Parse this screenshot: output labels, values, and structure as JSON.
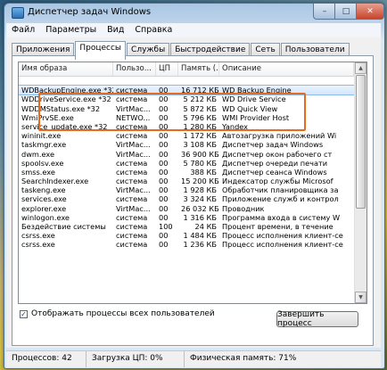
{
  "window": {
    "title": "Диспетчер задач Windows",
    "minimize": "–",
    "maximize": "□",
    "close": "✕"
  },
  "menu": [
    "Файл",
    "Параметры",
    "Вид",
    "Справка"
  ],
  "tabs": [
    "Приложения",
    "Процессы",
    "Службы",
    "Быстродействие",
    "Сеть",
    "Пользователи"
  ],
  "active_tab": "Процессы",
  "columns": [
    "Имя образа",
    "Пользо...",
    "ЦП",
    "Память (...",
    "Описание"
  ],
  "rows": [
    [
      "",
      "",
      "",
      "",
      ""
    ],
    [
      "WDBackupEngine.exe *32",
      "система",
      "00",
      "16 712 КБ",
      "WD Backup Engine"
    ],
    [
      "WDDriveService.exe *32",
      "система",
      "00",
      "5 212 КБ",
      "WD Drive Service"
    ],
    [
      "WDDMStatus.exe *32",
      "VirtMac...",
      "00",
      "5 872 КБ",
      "WD Quick View"
    ],
    [
      "WmiPrvSE.exe",
      "NETWO...",
      "00",
      "5 796 КБ",
      "WMI Provider Host"
    ],
    [
      "service_update.exe *32",
      "система",
      "00",
      "1 280 КБ",
      "Yandex"
    ],
    [
      "wininit.exe",
      "система",
      "00",
      "1 172 КБ",
      "Автозагрузка приложений Wi"
    ],
    [
      "taskmgr.exe",
      "VirtMac...",
      "00",
      "3 108 КБ",
      "Диспетчер задач Windows"
    ],
    [
      "dwm.exe",
      "VirtMac...",
      "00",
      "36 900 КБ",
      "Диспетчер окон рабочего ст"
    ],
    [
      "spoolsv.exe",
      "система",
      "00",
      "5 780 КБ",
      "Диспетчер очереди печати"
    ],
    [
      "smss.exe",
      "система",
      "00",
      "388 КБ",
      "Диспетчер сеанса Windows"
    ],
    [
      "SearchIndexer.exe",
      "система",
      "00",
      "15 200 КБ",
      "Индексатор службы Microsof"
    ],
    [
      "taskeng.exe",
      "VirtMac...",
      "00",
      "1 928 КБ",
      "Обработчик планировщика за"
    ],
    [
      "services.exe",
      "система",
      "00",
      "3 324 КБ",
      "Приложение служб и контрол"
    ],
    [
      "explorer.exe",
      "VirtMac...",
      "00",
      "26 032 КБ",
      "Проводник"
    ],
    [
      "winlogon.exe",
      "система",
      "00",
      "1 316 КБ",
      "Программа входа в систему W"
    ],
    [
      "Бездействие системы",
      "система",
      "100",
      "24 КБ",
      "Процент времени, в течение"
    ],
    [
      "csrss.exe",
      "система",
      "00",
      "1 484 КБ",
      "Процесс исполнения клиент-се"
    ],
    [
      "csrss.exe",
      "система",
      "00",
      "1 236 КБ",
      "Процесс исполнения клиент-се"
    ]
  ],
  "show_all": {
    "label": "Отображать процессы всех пользователей",
    "checked": "✓"
  },
  "end_process": "Завершить процесс",
  "status": {
    "processes": "Процессов: 42",
    "cpu": "Загрузка ЦП: 0%",
    "memory": "Физическая память: 71%"
  },
  "scroll": {
    "up": "▲",
    "down": "▼"
  }
}
